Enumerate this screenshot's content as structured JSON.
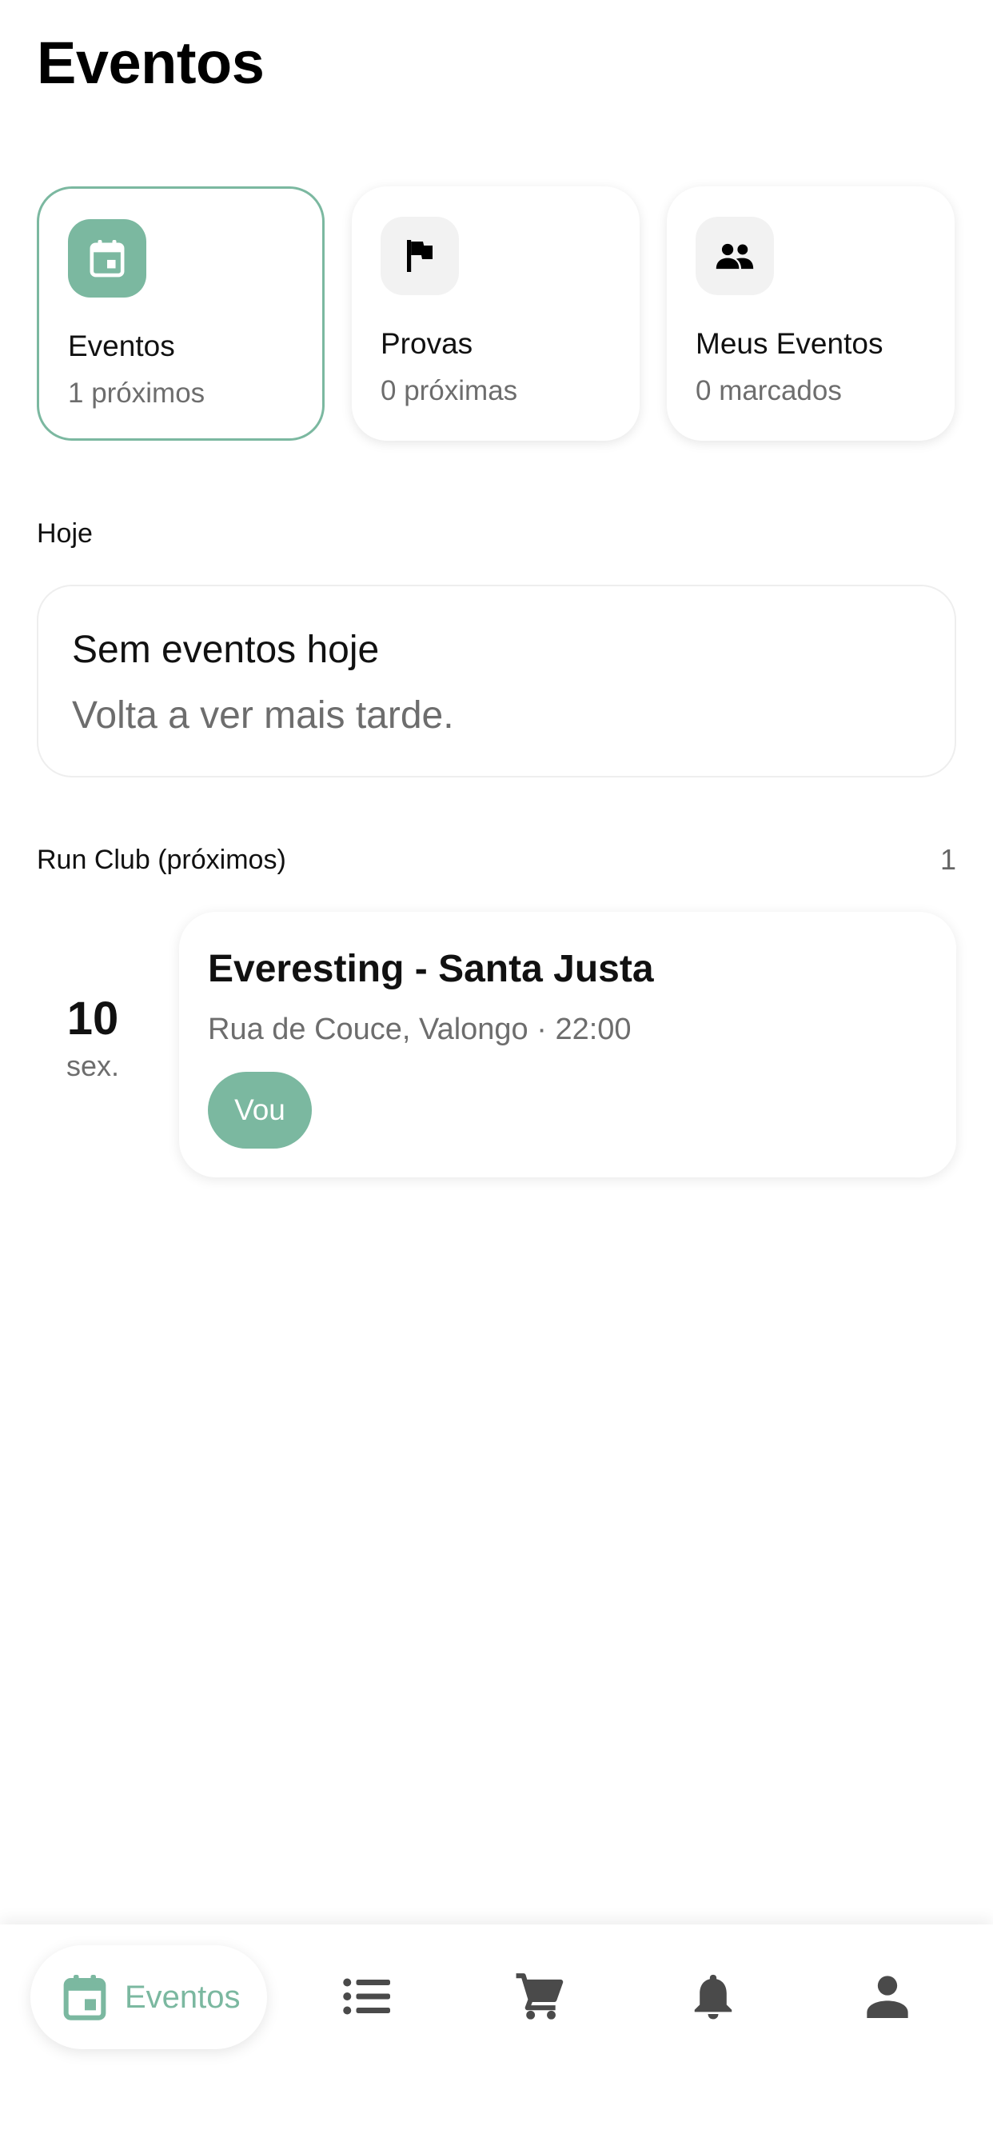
{
  "header": {
    "title": "Eventos"
  },
  "summary_cards": [
    {
      "title": "Eventos",
      "subtitle": "1 próximos",
      "icon": "calendar-icon",
      "active": true
    },
    {
      "title": "Provas",
      "subtitle": "0 próximas",
      "icon": "flag-icon",
      "active": false
    },
    {
      "title": "Meus Eventos",
      "subtitle": "0 marcados",
      "icon": "people-icon",
      "active": false
    }
  ],
  "today": {
    "label": "Hoje",
    "empty_title": "Sem eventos hoje",
    "empty_subtitle": "Volta a ver mais tarde."
  },
  "run_club": {
    "label": "Run Club (próximos)",
    "count": "1",
    "events": [
      {
        "day": "10",
        "weekday": "sex.",
        "title": "Everesting - Santa Justa",
        "meta": "Rua de Couce, Valongo · 22:00",
        "rsvp_label": "Vou"
      }
    ]
  },
  "bottom_nav": {
    "active_label": "Eventos",
    "items": [
      "calendar-icon",
      "list-icon",
      "cart-icon",
      "bell-icon",
      "person-icon"
    ]
  },
  "colors": {
    "accent": "#7bb8a0",
    "text": "#111111",
    "muted": "#6d6d6d",
    "icon_dark": "#4a4a4a"
  }
}
